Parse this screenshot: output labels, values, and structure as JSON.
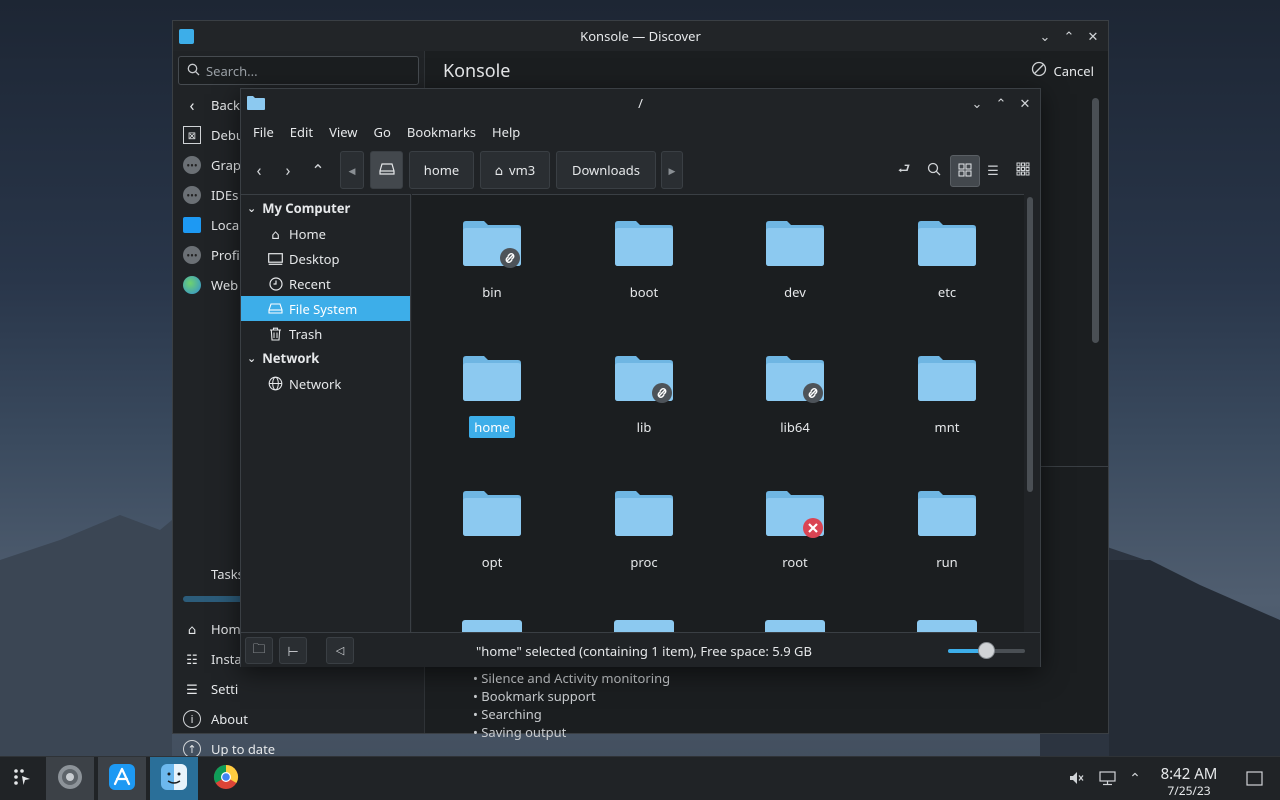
{
  "discover": {
    "title": "Konsole — Discover",
    "search_placeholder": "Search...",
    "header_title": "Konsole",
    "cancel_label": "Cancel",
    "sidebar_top": [
      {
        "label": "Back",
        "icon": "chevron-left-icon"
      },
      {
        "label": "Debu",
        "icon": "debug-icon"
      },
      {
        "label": "Grap",
        "icon": "graphics-icon"
      },
      {
        "label": "IDEs",
        "icon": "ide-icon"
      },
      {
        "label": "Loca",
        "icon": "localization-icon"
      },
      {
        "label": "Profi",
        "icon": "profile-icon"
      },
      {
        "label": "Web",
        "icon": "globe-icon"
      }
    ],
    "tasks_label": "Tasks",
    "sidebar_bottom": [
      {
        "label": "Hom",
        "icon": "home-icon"
      },
      {
        "label": "Insta",
        "icon": "installed-icon"
      },
      {
        "label": "Setti",
        "icon": "settings-icon"
      },
      {
        "label": "About",
        "icon": "info-icon"
      },
      {
        "label": "Up to date",
        "icon": "upload-icon"
      }
    ],
    "features": [
      "• Silence and Activity monitoring",
      "• Bookmark support",
      "• Searching",
      "• Saving output"
    ]
  },
  "dolphin": {
    "title": "/",
    "menu": [
      "File",
      "Edit",
      "View",
      "Go",
      "Bookmarks",
      "Help"
    ],
    "breadcrumbs": [
      "home",
      "vm3",
      "Downloads"
    ],
    "places": {
      "my_computer_header": "My Computer",
      "my_computer_items": [
        {
          "label": "Home",
          "icon": "home-icon"
        },
        {
          "label": "Desktop",
          "icon": "desktop-icon"
        },
        {
          "label": "Recent",
          "icon": "clock-icon"
        },
        {
          "label": "File System",
          "icon": "drive-icon"
        },
        {
          "label": "Trash",
          "icon": "trash-icon"
        }
      ],
      "network_header": "Network",
      "network_items": [
        {
          "label": "Network",
          "icon": "network-icon"
        }
      ]
    },
    "files": [
      {
        "name": "bin",
        "badge": "link"
      },
      {
        "name": "boot",
        "badge": ""
      },
      {
        "name": "dev",
        "badge": ""
      },
      {
        "name": "etc",
        "badge": ""
      },
      {
        "name": "home",
        "badge": "",
        "selected": true
      },
      {
        "name": "lib",
        "badge": "link"
      },
      {
        "name": "lib64",
        "badge": "link"
      },
      {
        "name": "mnt",
        "badge": ""
      },
      {
        "name": "opt",
        "badge": ""
      },
      {
        "name": "proc",
        "badge": ""
      },
      {
        "name": "root",
        "badge": "locked"
      },
      {
        "name": "run",
        "badge": ""
      }
    ],
    "status_text": "\"home\" selected (containing 1 item), Free space: 5.9 GB",
    "zoom_level_fraction": 0.5
  },
  "taskbar": {
    "time": "8:42 AM",
    "date": "7/25/23"
  },
  "colors": {
    "accent": "#3daee9",
    "folder": "#8cc9f0",
    "folder_tab": "#6fb6e3"
  }
}
